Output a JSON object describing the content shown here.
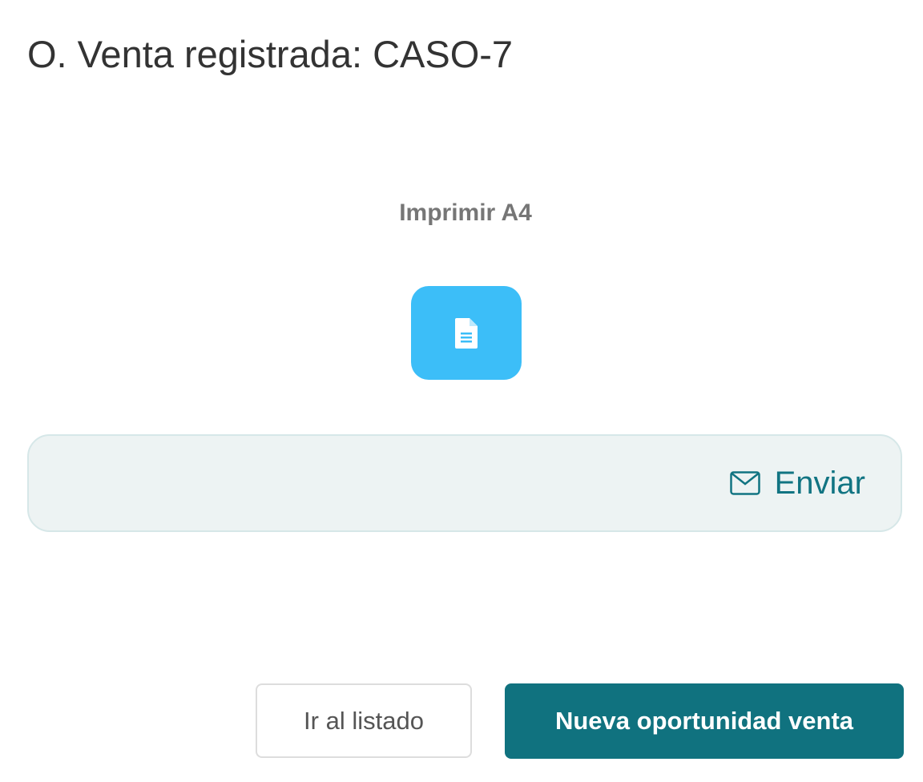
{
  "header": {
    "title": "O. Venta registrada: CASO-7"
  },
  "print": {
    "label": "Imprimir A4",
    "icon": "document-icon",
    "button_color": "#3cbef8"
  },
  "send": {
    "label": "Enviar",
    "icon": "envelope-icon",
    "text_color": "#117482"
  },
  "actions": {
    "list_label": "Ir al listado",
    "new_label": "Nueva oportunidad venta",
    "primary_color": "#10727f"
  }
}
